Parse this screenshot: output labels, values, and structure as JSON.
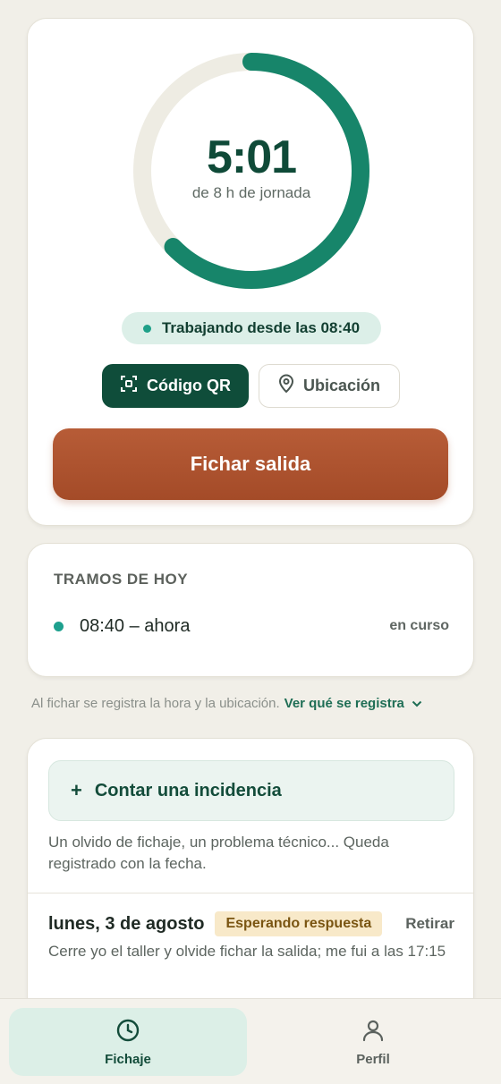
{
  "timer": {
    "time": "5:01",
    "subtitle": "de 8 h de jornada",
    "progress_fraction": 0.627
  },
  "status": {
    "text": "Trabajando desde las 08:40"
  },
  "buttons": {
    "qr_label": "Código QR",
    "location_label": "Ubicación",
    "main_label": "Fichar salida"
  },
  "tramos": {
    "title": "TRAMOS DE HOY",
    "items": [
      {
        "range": "08:40 – ahora",
        "state": "en curso"
      }
    ]
  },
  "info": {
    "text": "Al fichar se registra la hora y la ubicación.",
    "link": "Ver qué se registra"
  },
  "incidencias": {
    "button_label": "Contar una incidencia",
    "description": "Un olvido de fichaje, un problema técnico... Queda registrado con la fecha.",
    "items": [
      {
        "date": "lunes, 3 de agosto",
        "badge": "Esperando respuesta",
        "action": "Retirar",
        "text": "Cerre yo el taller y olvide fichar la salida; me fui a las 17:15"
      }
    ]
  },
  "nav": {
    "items": [
      {
        "label": "Fichaje",
        "icon": "clock-icon",
        "active": true
      },
      {
        "label": "Perfil",
        "icon": "user-icon",
        "active": false
      }
    ]
  },
  "colors": {
    "accent": "#0f4d3a",
    "ring_progress": "#17856a",
    "ring_track": "#eeece3",
    "primary_action": "#ad5330",
    "badge_bg": "#f8e9c9"
  }
}
